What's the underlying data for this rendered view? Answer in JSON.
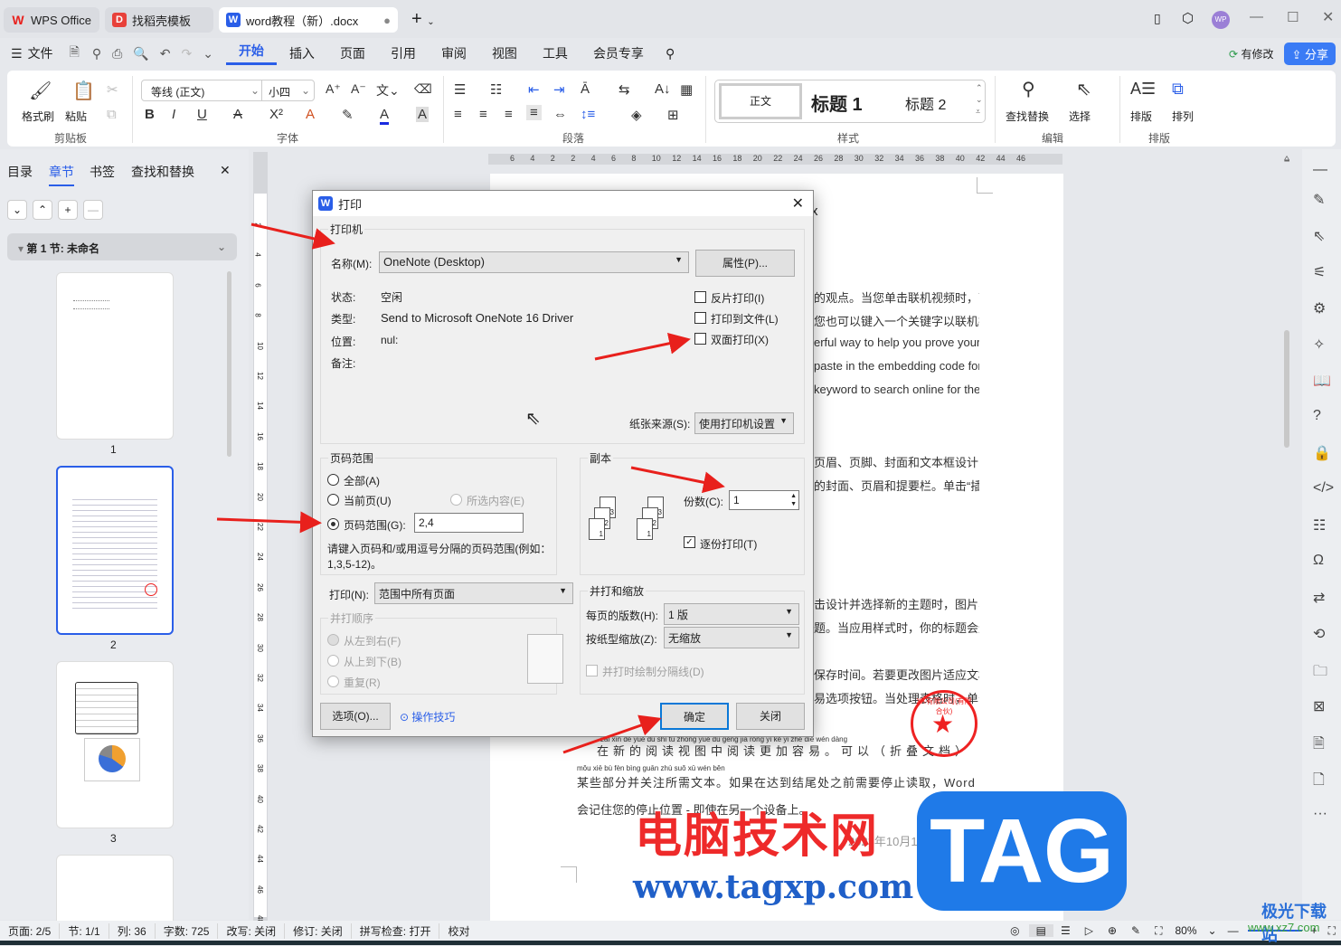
{
  "tabs": [
    {
      "label": "WPS Office"
    },
    {
      "label": "找稻壳模板"
    },
    {
      "label": "word教程（新）.docx"
    }
  ],
  "menu": {
    "file": "文件",
    "items": [
      "开始",
      "插入",
      "页面",
      "引用",
      "审阅",
      "视图",
      "工具",
      "会员专享"
    ],
    "modified": "有修改",
    "share": "分享",
    "avatar": "WP"
  },
  "ribbon": {
    "format_painter": "格式刷",
    "paste": "粘贴",
    "clipboard": "剪贴板",
    "font_name": "等线 (正文)",
    "font_size": "小四",
    "font": "字体",
    "paragraph": "段落",
    "styles": [
      "正文",
      "标题 1",
      "标题 2"
    ],
    "styles_label": "样式",
    "find_replace": "查找替换",
    "select": "选择",
    "edit": "编辑",
    "layout": "排版",
    "arrange": "排列",
    "layout_group": "排版"
  },
  "left_panel": {
    "tabs": [
      "目录",
      "章节",
      "书签",
      "查找和替换"
    ],
    "section": "第 1 节: 未命名",
    "pages": [
      "1",
      "2",
      "3"
    ]
  },
  "ruler": {
    "h": [
      "6",
      "4",
      "2",
      "2",
      "4",
      "6",
      "8",
      "10",
      "12",
      "14",
      "16",
      "18",
      "20",
      "22",
      "24",
      "26",
      "28",
      "30",
      "32",
      "34",
      "36",
      "38",
      "40",
      "42",
      "44",
      "46"
    ],
    "v": [
      "2",
      "4",
      "6",
      "8",
      "10",
      "12",
      "14",
      "16",
      "18",
      "20",
      "22",
      "24",
      "26",
      "28",
      "30",
      "32",
      "34",
      "36",
      "38",
      "40",
      "42",
      "44",
      "46",
      "48"
    ]
  },
  "doc": {
    "lines": [
      "的观点。当您单击联机视频时，可",
      "您也可以键入一个关键字以联机搜",
      "erful way to help you prove your",
      "paste in the embedding code for",
      "keyword to search online for the",
      "页眉、页脚、封面和文本框设计，",
      "的封面、页眉和提要栏。单击“插",
      "击设计并选择新的主题时，图片、",
      "题。当应用样式时，你的标题会进",
      "保存时间。若要更改图片适应文档",
      "易选项按钮。当处理表格时，单击"
    ],
    "pinyin1": "zài xīn de yuè dú shì tú zhōng yuè dú gèng jiā róng yì   kě yǐ   zhé dié wén dàng",
    "line_a": "在新的阅读视图中阅读更加容易。可以（折叠文档）",
    "pinyin2": "mǒu xiē bù fèn bìng guān zhù suǒ xū wén běn",
    "line_b": "某些部分并关注所需文本。如果在达到结尾处之前需要停止读取，Word",
    "line_c": "会记住您的停止位置 - 即使在另一个设备上。",
    "date": "2023年10月17日星期二",
    "stamp": "XX有限公司(有限合伙)"
  },
  "dialog": {
    "title": "打印",
    "printer_group": "打印机",
    "name_label": "名称(M):",
    "printer": "OneNote (Desktop)",
    "properties": "属性(P)...",
    "status_label": "状态:",
    "status": "空闲",
    "type_label": "类型:",
    "type": "Send to Microsoft OneNote 16 Driver",
    "location_label": "位置:",
    "location": "nul:",
    "comment_label": "备注:",
    "reverse": "反片打印(I)",
    "to_file": "打印到文件(L)",
    "duplex": "双面打印(X)",
    "paper_label": "纸张来源(S):",
    "paper": "使用打印机设置",
    "range_group": "页码范围",
    "all": "全部(A)",
    "current": "当前页(U)",
    "selection": "所选内容(E)",
    "pages_label": "页码范围(G):",
    "pages": "2,4",
    "hint": "请键入页码和/或用逗号分隔的页码范围(例如：",
    "hint2": "1,3,5-12)。",
    "copies_group": "副本",
    "copies_label": "份数(C):",
    "copies": "1",
    "collate": "逐份打印(T)",
    "print_label": "打印(N):",
    "print_what": "范围中所有页面",
    "order_group": "并打顺序",
    "ltr": "从左到右(F)",
    "ttb": "从上到下(B)",
    "repeat": "重复(R)",
    "zoom_group": "并打和缩放",
    "pps_label": "每页的版数(H):",
    "pps": "1 版",
    "scale_label": "按纸型缩放(Z):",
    "scale": "无缩放",
    "draw_lines": "并打时绘制分隔线(D)",
    "options": "选项(O)...",
    "tips": "操作技巧",
    "ok": "确定",
    "close": "关闭"
  },
  "status": {
    "page": "页面: 2/5",
    "section": "节: 1/1",
    "col": "列: 36",
    "words": "字数: 725",
    "overtype": "改写: 关闭",
    "track": "修订: 关闭",
    "spell": "拼写检查: 打开",
    "proof": "校对",
    "zoom": "80%"
  },
  "watermark": {
    "cn": "电脑技术网",
    "url": "www.tagxp.com",
    "tag": "TAG",
    "site": "极光下载站",
    "site_url": "www.xz7.com"
  },
  "colors": {
    "accent": "#2a5ee8",
    "arrow": "#e8201c",
    "watermark_red": "#ee2a2a",
    "tag_blue": "#1f7ae8"
  }
}
